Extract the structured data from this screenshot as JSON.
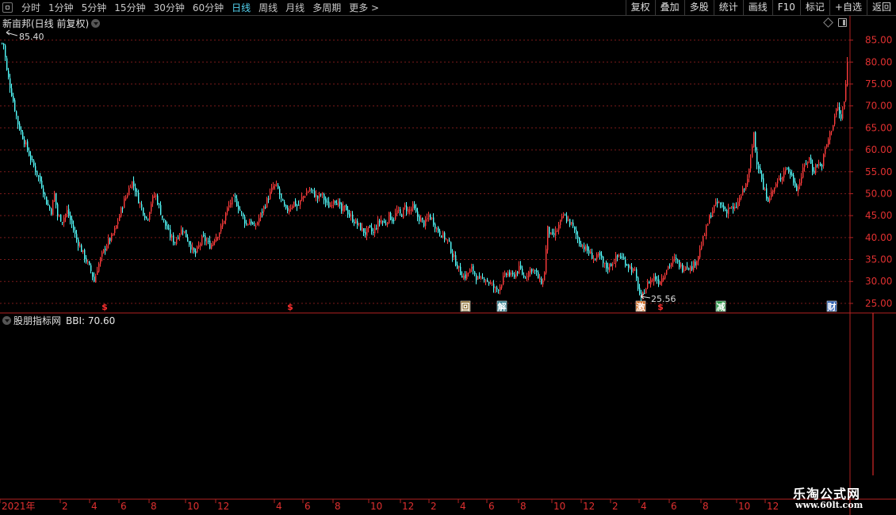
{
  "toolbar": {
    "periods": [
      {
        "label": "分时",
        "active": false
      },
      {
        "label": "1分钟",
        "active": false
      },
      {
        "label": "5分钟",
        "active": false
      },
      {
        "label": "15分钟",
        "active": false
      },
      {
        "label": "30分钟",
        "active": false
      },
      {
        "label": "60分钟",
        "active": false
      },
      {
        "label": "日线",
        "active": true
      },
      {
        "label": "周线",
        "active": false
      },
      {
        "label": "月线",
        "active": false
      },
      {
        "label": "多周期",
        "active": false
      },
      {
        "label": "更多 >",
        "active": false
      }
    ],
    "right_buttons": [
      "复权",
      "叠加",
      "多股",
      "统计",
      "画线",
      "F10",
      "标记",
      "+自选",
      "返回"
    ]
  },
  "main": {
    "title": "新亩邦(日线 前复权)",
    "price_high_label": "85.40",
    "price_low_label": "25.56",
    "y_ticks": [
      "85.00",
      "80.00",
      "75.00",
      "70.00",
      "65.00",
      "60.00",
      "55.00",
      "50.00",
      "45.00",
      "40.00",
      "35.00",
      "30.00",
      "25.00"
    ]
  },
  "sub": {
    "title": "股朋指标网",
    "bbi_label": "BBI: 70.60"
  },
  "markers": [
    {
      "text": "$",
      "color": "#ff3030",
      "bg": "none",
      "price": 23.2
    },
    {
      "text": "$",
      "color": "#ff3030",
      "bg": "none",
      "price": 23.2
    },
    {
      "text": "回",
      "color": "#ffffff",
      "bg": "#8a6a2a",
      "price": 23.2
    },
    {
      "text": "解",
      "color": "#ffffff",
      "bg": "#2a7a8a",
      "price": 23.2
    },
    {
      "text": "激",
      "color": "#ffffff",
      "bg": "#d06a20",
      "price": 23.2
    },
    {
      "text": "$",
      "color": "#ff3030",
      "bg": "none",
      "price": 23.2
    },
    {
      "text": "减",
      "color": "#ffffff",
      "bg": "#2e9a4a",
      "price": 23.2
    },
    {
      "text": "财",
      "color": "#ffffff",
      "bg": "#2d5fb0",
      "price": 23.2
    }
  ],
  "x_axis": {
    "labels": [
      "2021年",
      "2",
      "4",
      "6",
      "8",
      "10",
      "12",
      "4",
      "6",
      "8",
      "10",
      "12",
      "2",
      "4",
      "6",
      "8",
      "10",
      "12",
      "2",
      "4",
      "6",
      "8",
      "10",
      "12"
    ]
  },
  "watermark": {
    "site": "乐淘公式网",
    "url": "www.60lt.com"
  },
  "colors": {
    "up": "#ff3c3c",
    "down": "#54ffff",
    "grid": "#7a1a1a",
    "axis": "#b22222",
    "active_tab": "#53d3f0"
  },
  "chart_data": {
    "type": "candlestick",
    "ylim": [
      23,
      88
    ],
    "path": [
      [
        0,
        82
      ],
      [
        3,
        85.4
      ],
      [
        8,
        78
      ],
      [
        15,
        72
      ],
      [
        22,
        66
      ],
      [
        30,
        62
      ],
      [
        38,
        58
      ],
      [
        45,
        55
      ],
      [
        52,
        52
      ],
      [
        58,
        48
      ],
      [
        64,
        46
      ],
      [
        68,
        50
      ],
      [
        72,
        45
      ],
      [
        78,
        44
      ],
      [
        84,
        46
      ],
      [
        90,
        43
      ],
      [
        95,
        40
      ],
      [
        100,
        38
      ],
      [
        105,
        36
      ],
      [
        110,
        34
      ],
      [
        115,
        32
      ],
      [
        118,
        30
      ],
      [
        122,
        33
      ],
      [
        128,
        36
      ],
      [
        135,
        39
      ],
      [
        140,
        40
      ],
      [
        145,
        42
      ],
      [
        150,
        45
      ],
      [
        155,
        48
      ],
      [
        160,
        50
      ],
      [
        165,
        53
      ],
      [
        170,
        51
      ],
      [
        175,
        48
      ],
      [
        180,
        46
      ],
      [
        185,
        44
      ],
      [
        190,
        48
      ],
      [
        195,
        50
      ],
      [
        200,
        47
      ],
      [
        205,
        44
      ],
      [
        210,
        42
      ],
      [
        215,
        40
      ],
      [
        220,
        39
      ],
      [
        225,
        41
      ],
      [
        230,
        42
      ],
      [
        235,
        40
      ],
      [
        240,
        38
      ],
      [
        245,
        36
      ],
      [
        250,
        38
      ],
      [
        255,
        40
      ],
      [
        260,
        39
      ],
      [
        265,
        38
      ],
      [
        270,
        40
      ],
      [
        275,
        41
      ],
      [
        280,
        43
      ],
      [
        285,
        46
      ],
      [
        290,
        48
      ],
      [
        295,
        49
      ],
      [
        300,
        47
      ],
      [
        305,
        45
      ],
      [
        310,
        43
      ],
      [
        315,
        44
      ],
      [
        320,
        42
      ],
      [
        325,
        44
      ],
      [
        330,
        46
      ],
      [
        335,
        48
      ],
      [
        340,
        50
      ],
      [
        345,
        52
      ],
      [
        350,
        51
      ],
      [
        355,
        48
      ],
      [
        360,
        46
      ],
      [
        365,
        47
      ],
      [
        370,
        48
      ],
      [
        375,
        47
      ],
      [
        380,
        49
      ],
      [
        385,
        50
      ],
      [
        390,
        51
      ],
      [
        395,
        50
      ],
      [
        400,
        49
      ],
      [
        405,
        50
      ],
      [
        410,
        48
      ],
      [
        415,
        47
      ],
      [
        420,
        49
      ],
      [
        425,
        48
      ],
      [
        430,
        46
      ],
      [
        435,
        47
      ],
      [
        440,
        45
      ],
      [
        445,
        44
      ],
      [
        450,
        43
      ],
      [
        455,
        42
      ],
      [
        460,
        41
      ],
      [
        465,
        42
      ],
      [
        470,
        41
      ],
      [
        475,
        43
      ],
      [
        480,
        44
      ],
      [
        485,
        43
      ],
      [
        490,
        45
      ],
      [
        495,
        44
      ],
      [
        500,
        46
      ],
      [
        505,
        45
      ],
      [
        510,
        47
      ],
      [
        515,
        46
      ],
      [
        520,
        47
      ],
      [
        525,
        45
      ],
      [
        530,
        44
      ],
      [
        535,
        43
      ],
      [
        540,
        45
      ],
      [
        545,
        44
      ],
      [
        550,
        42
      ],
      [
        555,
        41
      ],
      [
        560,
        40
      ],
      [
        565,
        39
      ],
      [
        570,
        36
      ],
      [
        575,
        34
      ],
      [
        580,
        32
      ],
      [
        585,
        31
      ],
      [
        590,
        32
      ],
      [
        595,
        33
      ],
      [
        600,
        31
      ],
      [
        605,
        30
      ],
      [
        610,
        31
      ],
      [
        615,
        30
      ],
      [
        620,
        29
      ],
      [
        625,
        28
      ],
      [
        630,
        29
      ],
      [
        635,
        31
      ],
      [
        640,
        32
      ],
      [
        645,
        31
      ],
      [
        650,
        32
      ],
      [
        655,
        33
      ],
      [
        660,
        31
      ],
      [
        665,
        32
      ],
      [
        670,
        33
      ],
      [
        675,
        32
      ],
      [
        680,
        30
      ],
      [
        685,
        30
      ],
      [
        690,
        42
      ],
      [
        695,
        40
      ],
      [
        700,
        41
      ],
      [
        705,
        43
      ],
      [
        710,
        45
      ],
      [
        715,
        44
      ],
      [
        720,
        43
      ],
      [
        725,
        41
      ],
      [
        730,
        39
      ],
      [
        735,
        38
      ],
      [
        740,
        37
      ],
      [
        745,
        36
      ],
      [
        750,
        35
      ],
      [
        755,
        36
      ],
      [
        760,
        34
      ],
      [
        765,
        33
      ],
      [
        770,
        34
      ],
      [
        775,
        35
      ],
      [
        780,
        36
      ],
      [
        785,
        35
      ],
      [
        790,
        34
      ],
      [
        795,
        33
      ],
      [
        800,
        32
      ],
      [
        805,
        28
      ],
      [
        808,
        25.56
      ],
      [
        812,
        28
      ],
      [
        818,
        30
      ],
      [
        825,
        31
      ],
      [
        830,
        30
      ],
      [
        835,
        31
      ],
      [
        840,
        33
      ],
      [
        845,
        34
      ],
      [
        850,
        35
      ],
      [
        855,
        34
      ],
      [
        860,
        33
      ],
      [
        865,
        34
      ],
      [
        870,
        33
      ],
      [
        875,
        34
      ],
      [
        880,
        36
      ],
      [
        885,
        39
      ],
      [
        890,
        42
      ],
      [
        895,
        45
      ],
      [
        900,
        47
      ],
      [
        905,
        48
      ],
      [
        910,
        47
      ],
      [
        915,
        46
      ],
      [
        920,
        47
      ],
      [
        925,
        46
      ],
      [
        930,
        48
      ],
      [
        935,
        50
      ],
      [
        940,
        52
      ],
      [
        945,
        56
      ],
      [
        950,
        64
      ],
      [
        953,
        58
      ],
      [
        958,
        55
      ],
      [
        962,
        51
      ],
      [
        968,
        49
      ],
      [
        972,
        50
      ],
      [
        978,
        52
      ],
      [
        985,
        54
      ],
      [
        990,
        56
      ],
      [
        995,
        55
      ],
      [
        1000,
        53
      ],
      [
        1005,
        51
      ],
      [
        1010,
        54
      ],
      [
        1015,
        57
      ],
      [
        1020,
        58
      ],
      [
        1025,
        55
      ],
      [
        1030,
        57
      ],
      [
        1035,
        56
      ],
      [
        1040,
        60
      ],
      [
        1045,
        63
      ],
      [
        1050,
        66
      ],
      [
        1055,
        70
      ],
      [
        1060,
        67
      ],
      [
        1065,
        72
      ],
      [
        1068,
        80
      ],
      [
        1070,
        78
      ]
    ]
  }
}
